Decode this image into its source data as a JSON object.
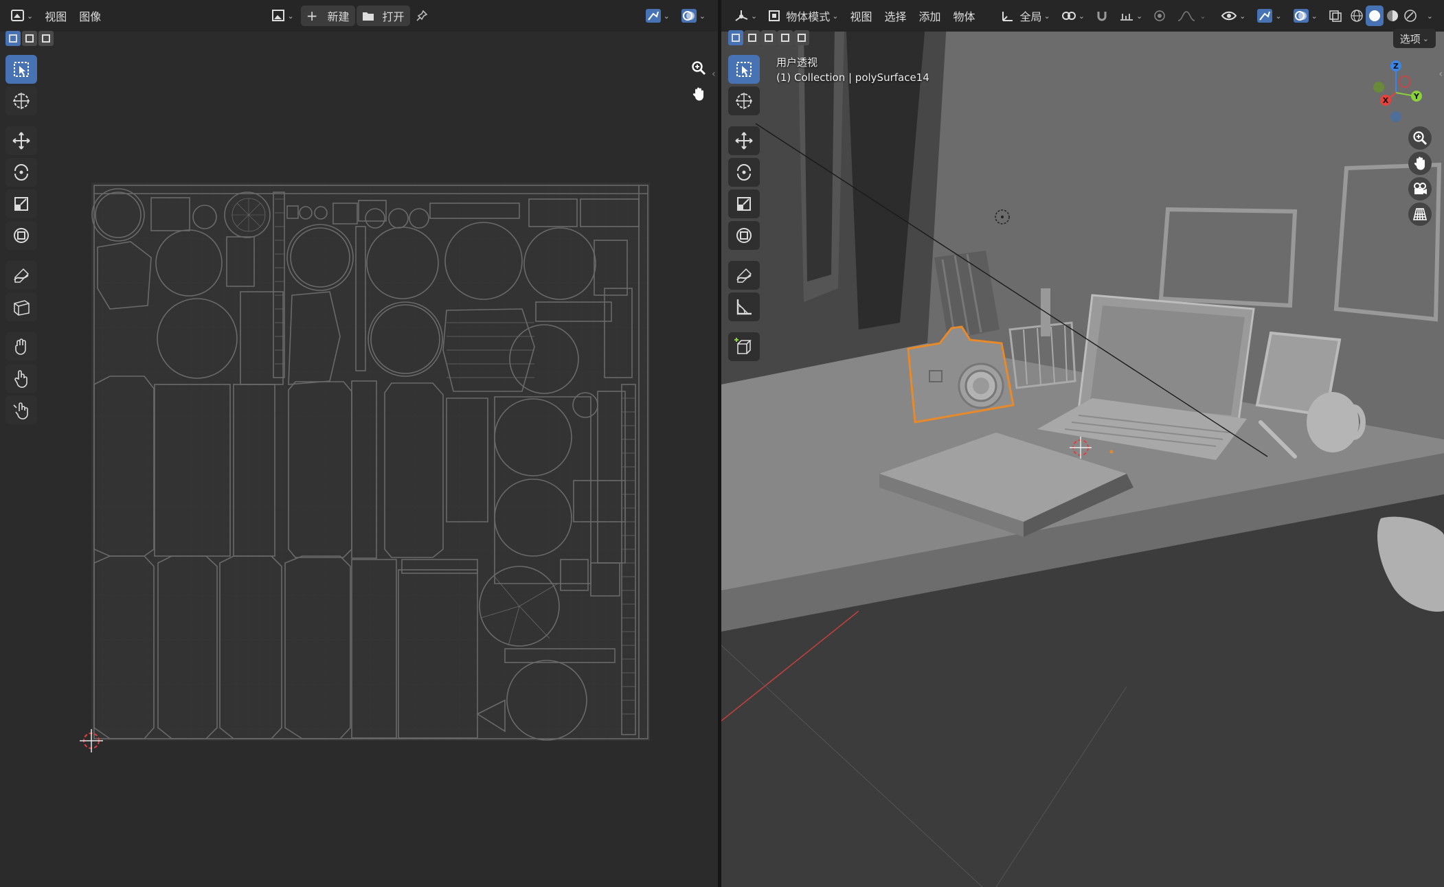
{
  "uv_editor": {
    "menus": [
      "视图",
      "图像"
    ],
    "new_label": "新建",
    "open_label": "打开"
  },
  "viewport": {
    "mode_label": "物体模式",
    "menus": [
      "视图",
      "选择",
      "添加",
      "物体"
    ],
    "transform_orientation": "全局",
    "options_label": "选项",
    "overlay_line1": "用户透视",
    "overlay_line2": "(1) Collection | polySurface14",
    "gizmo": {
      "x": "X",
      "y": "Y",
      "z": "Z"
    }
  },
  "colors": {
    "accent": "#4772b3",
    "selection_outline": "#e8892a",
    "header_bg": "#262626",
    "uv_bg": "#2b2b2b",
    "axis_x": "#e8413c",
    "axis_y": "#8bd13a",
    "axis_z": "#3a86e8"
  }
}
